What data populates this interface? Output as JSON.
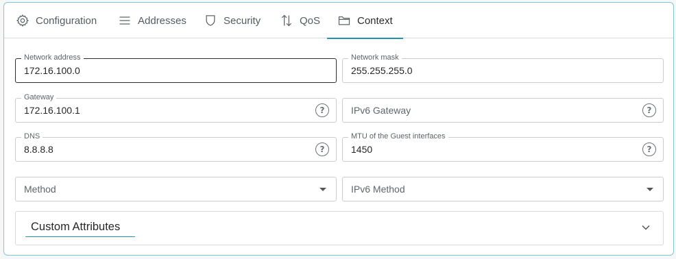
{
  "tabs": [
    {
      "label": "Configuration",
      "icon": "gear-icon",
      "active": false
    },
    {
      "label": "Addresses",
      "icon": "list-icon",
      "active": false
    },
    {
      "label": "Security",
      "icon": "shield-icon",
      "active": false
    },
    {
      "label": "QoS",
      "icon": "up-down-arrows-icon",
      "active": false
    },
    {
      "label": "Context",
      "icon": "folder-icon",
      "active": true
    }
  ],
  "form": {
    "network_address": {
      "label": "Network address",
      "value": "172.16.100.0"
    },
    "network_mask": {
      "label": "Network mask",
      "value": "255.255.255.0"
    },
    "gateway": {
      "label": "Gateway",
      "value": "172.16.100.1"
    },
    "ipv6_gateway": {
      "placeholder": "IPv6 Gateway"
    },
    "dns": {
      "label": "DNS",
      "value": "8.8.8.8"
    },
    "mtu": {
      "label": "MTU of the Guest interfaces",
      "value": "1450"
    },
    "method": {
      "placeholder": "Method"
    },
    "ipv6_method": {
      "placeholder": "IPv6 Method"
    }
  },
  "help_glyph": "?",
  "accordion": {
    "title": "Custom Attributes"
  },
  "colors": {
    "accent": "#1f93ab",
    "card_border": "#7fc7d3",
    "field_border": "#c8ccd0"
  }
}
